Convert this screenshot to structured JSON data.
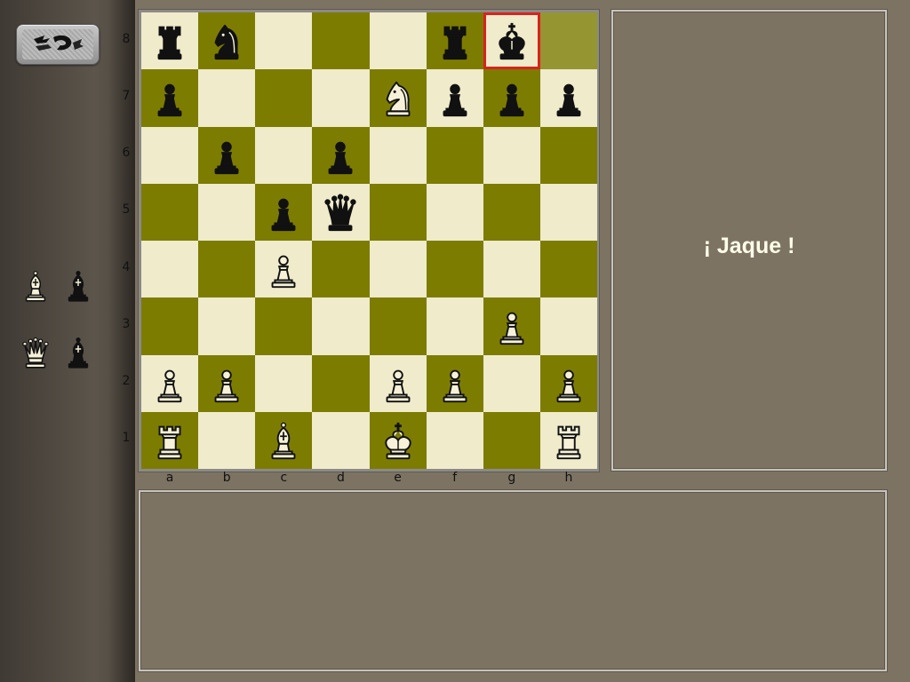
{
  "status_message": "¡ Jaque !",
  "ranks": [
    "8",
    "7",
    "6",
    "5",
    "4",
    "3",
    "2",
    "1"
  ],
  "files": [
    "a",
    "b",
    "c",
    "d",
    "e",
    "f",
    "g",
    "h"
  ],
  "colors": {
    "light_square": "#efebcb",
    "dark_square": "#7c7c00",
    "last_move_square": "#959531",
    "check_highlight": "#d8231f",
    "panel_bg": "#7d7363"
  },
  "board": [
    {
      "square": "a8",
      "piece": "rook",
      "color": "black"
    },
    {
      "square": "b8",
      "piece": "knight",
      "color": "black"
    },
    {
      "square": "f8",
      "piece": "rook",
      "color": "black"
    },
    {
      "square": "g8",
      "piece": "king",
      "color": "black"
    },
    {
      "square": "a7",
      "piece": "pawn",
      "color": "black"
    },
    {
      "square": "e7",
      "piece": "knight",
      "color": "white"
    },
    {
      "square": "f7",
      "piece": "pawn",
      "color": "black"
    },
    {
      "square": "g7",
      "piece": "pawn",
      "color": "black"
    },
    {
      "square": "h7",
      "piece": "pawn",
      "color": "black"
    },
    {
      "square": "b6",
      "piece": "pawn",
      "color": "black"
    },
    {
      "square": "d6",
      "piece": "pawn",
      "color": "black"
    },
    {
      "square": "c5",
      "piece": "pawn",
      "color": "black"
    },
    {
      "square": "d5",
      "piece": "queen",
      "color": "black"
    },
    {
      "square": "c4",
      "piece": "pawn",
      "color": "white"
    },
    {
      "square": "g3",
      "piece": "pawn",
      "color": "white"
    },
    {
      "square": "a2",
      "piece": "pawn",
      "color": "white"
    },
    {
      "square": "b2",
      "piece": "pawn",
      "color": "white"
    },
    {
      "square": "e2",
      "piece": "pawn",
      "color": "white"
    },
    {
      "square": "f2",
      "piece": "pawn",
      "color": "white"
    },
    {
      "square": "h2",
      "piece": "pawn",
      "color": "white"
    },
    {
      "square": "a1",
      "piece": "rook",
      "color": "white"
    },
    {
      "square": "c1",
      "piece": "bishop",
      "color": "white"
    },
    {
      "square": "e1",
      "piece": "king",
      "color": "white"
    },
    {
      "square": "h1",
      "piece": "rook",
      "color": "white"
    }
  ],
  "check_square": "g8",
  "last_move_square": "h8",
  "captured_pieces": [
    {
      "piece": "bishop",
      "color": "white"
    },
    {
      "piece": "bishop",
      "color": "black"
    },
    {
      "piece": "queen",
      "color": "white"
    },
    {
      "piece": "bishop",
      "color": "black"
    }
  ],
  "icons": {
    "logo": "chess-logo-icon"
  }
}
